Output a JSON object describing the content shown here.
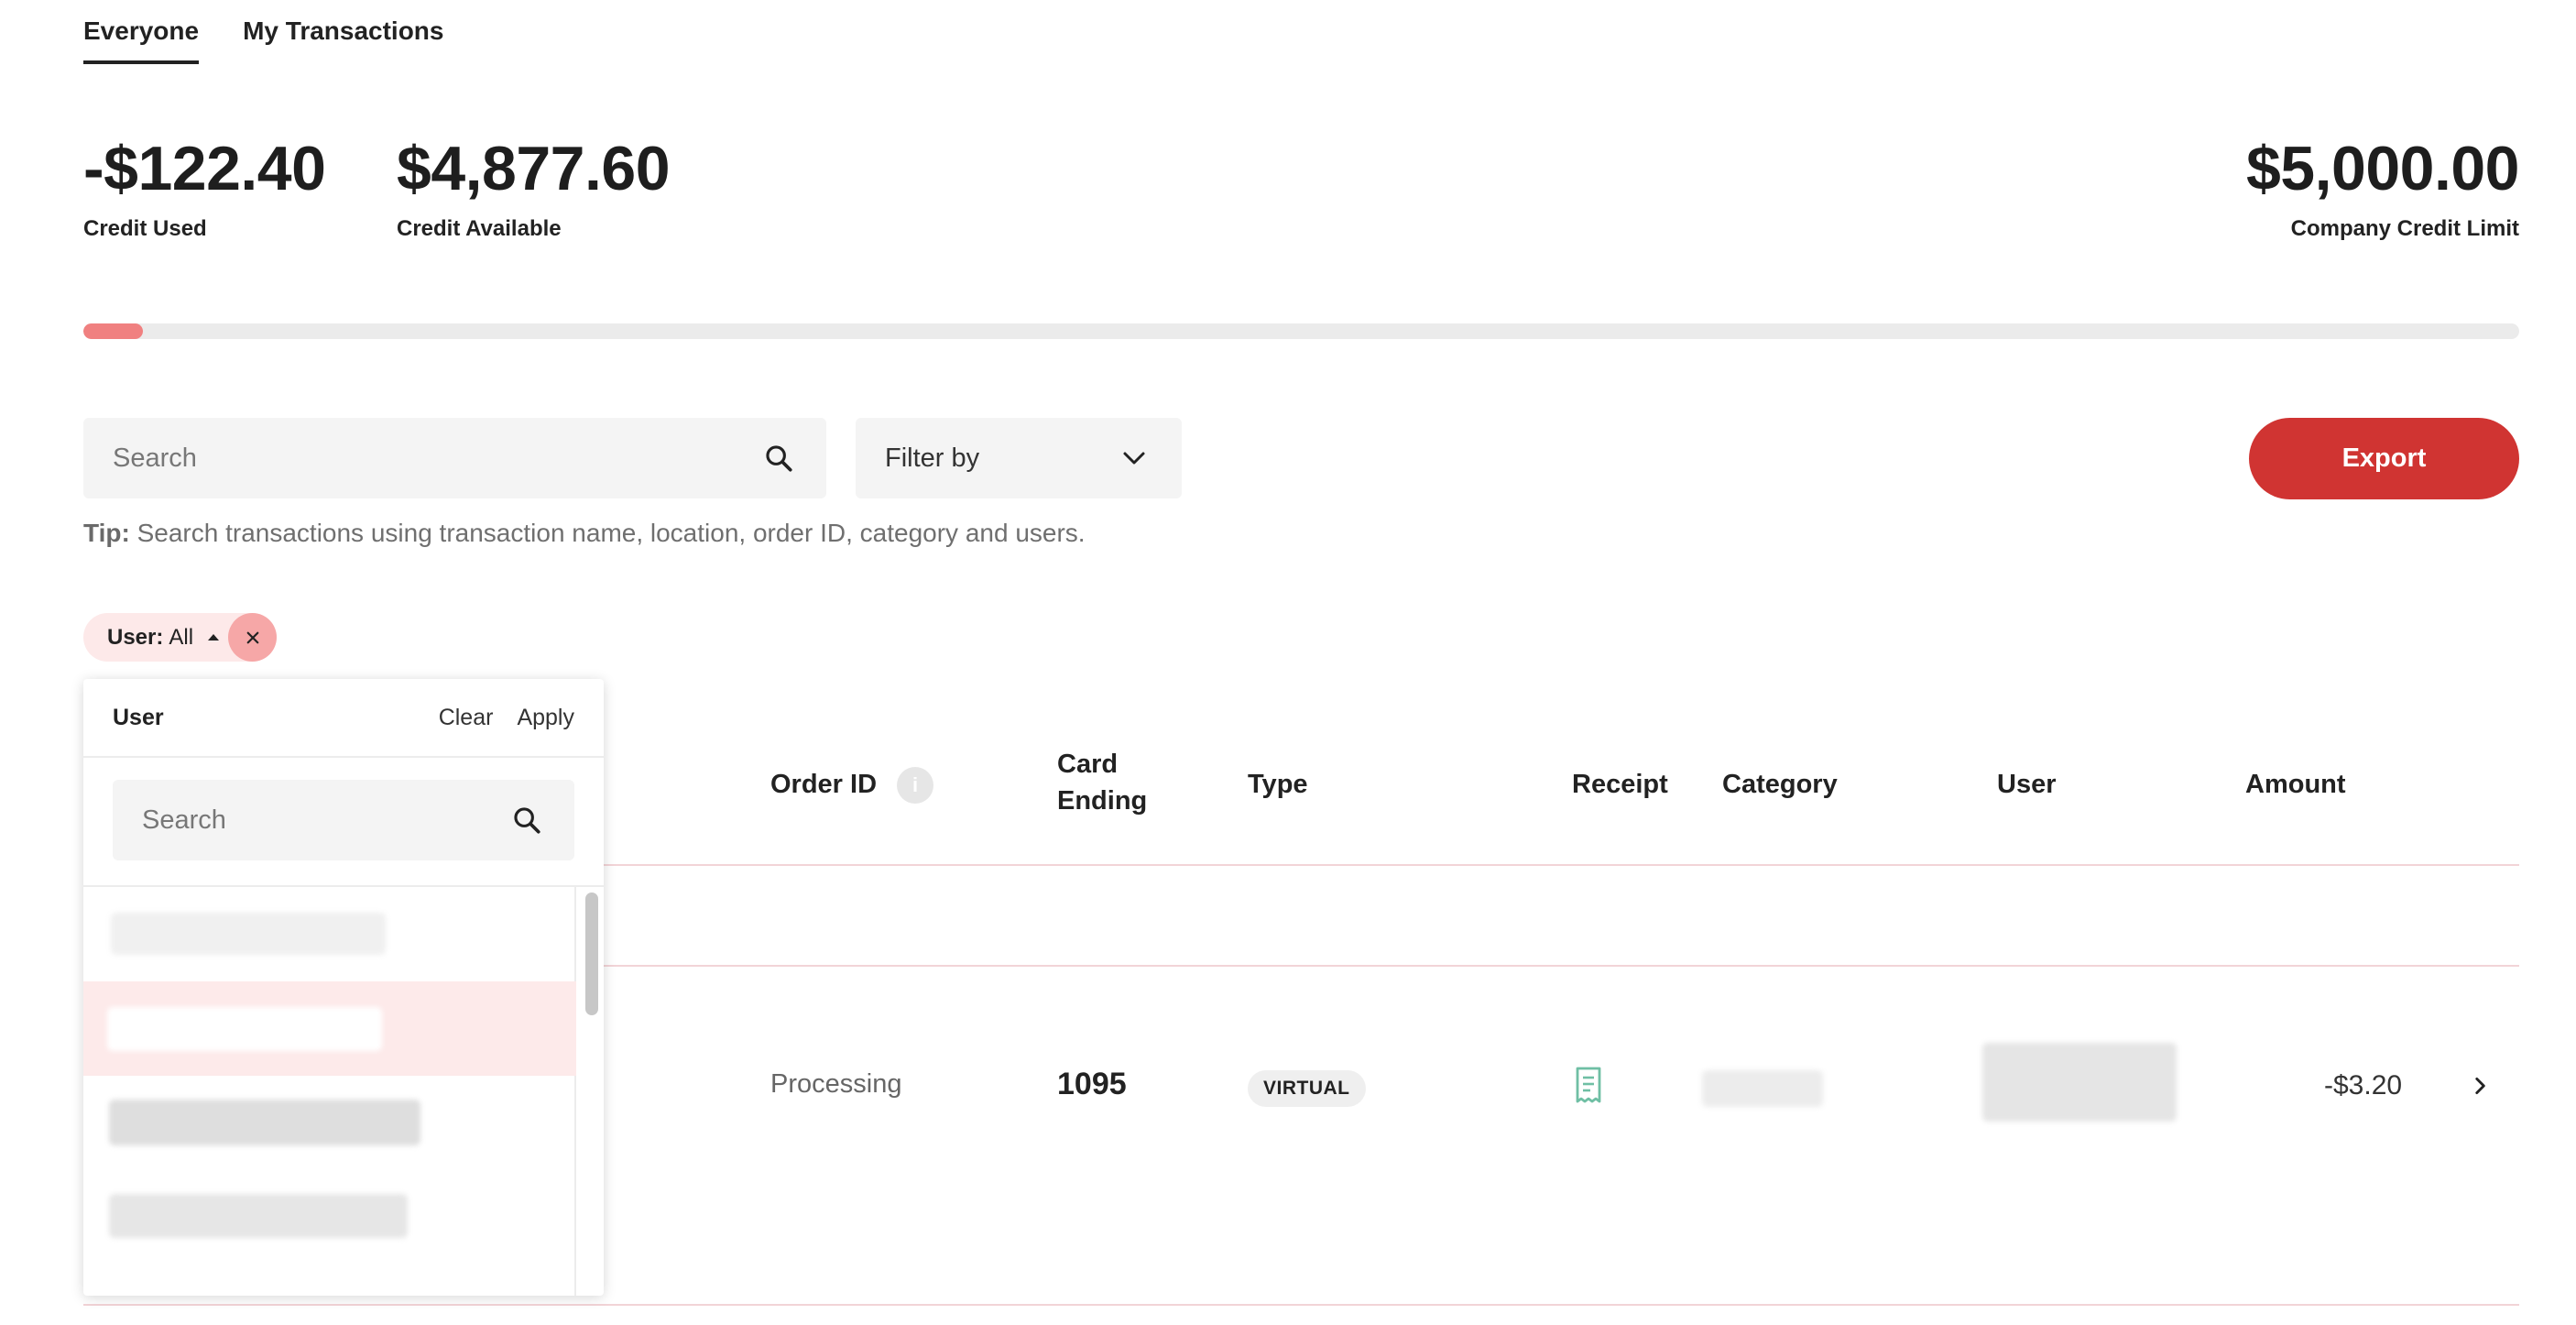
{
  "tabs": [
    {
      "label": "Everyone",
      "active": true
    },
    {
      "label": "My Transactions",
      "active": false
    }
  ],
  "stats": {
    "credit_used": {
      "value": "-$122.40",
      "label": "Credit Used"
    },
    "credit_available": {
      "value": "$4,877.60",
      "label": "Credit Available"
    },
    "credit_limit": {
      "value": "$5,000.00",
      "label": "Company Credit Limit"
    }
  },
  "progress": {
    "fraction_used": 0.0245,
    "fill_color": "#f08080"
  },
  "toolbar": {
    "search_placeholder": "Search",
    "filter_label": "Filter by",
    "export_label": "Export"
  },
  "tip": {
    "prefix": "Tip:",
    "text": " Search transactions using transaction name, location, order ID, category and users."
  },
  "chip": {
    "label": "User:",
    "value": "All"
  },
  "dropdown": {
    "title": "User",
    "clear_label": "Clear",
    "apply_label": "Apply",
    "search_placeholder": "Search"
  },
  "table": {
    "headers": {
      "order_id": "Order ID",
      "card_ending_1": "Card",
      "card_ending_2": "Ending",
      "type": "Type",
      "receipt": "Receipt",
      "category": "Category",
      "user": "User",
      "amount": "Amount"
    },
    "rows": [
      {
        "status": "Processing",
        "card_ending": "1095",
        "type": "VIRTUAL",
        "amount": "-$3.20"
      }
    ]
  },
  "colors": {
    "accent_red": "#d03432",
    "chip_bg": "#fde9e9",
    "receipt_icon": "#6fbfa4"
  }
}
